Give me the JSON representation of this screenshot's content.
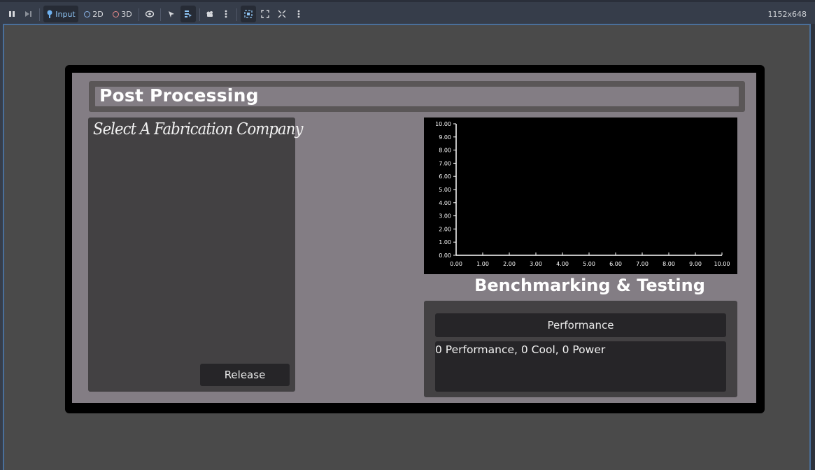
{
  "toolbar": {
    "input_label": "Input",
    "mode_2d_label": "2D",
    "mode_3d_label": "3D",
    "resolution": "1152x648",
    "accent_color": "#4a6f9a"
  },
  "game": {
    "title": "Post Processing",
    "fab_heading": "Select A Fabrication Company",
    "release_label": "Release",
    "bench_title": "Benchmarking & Testing",
    "performance_label": "Performance",
    "result_text": "0 Performance, 0 Cool, 0 Power"
  },
  "chart_data": {
    "type": "line",
    "xlim": [
      0,
      10
    ],
    "ylim": [
      0,
      10
    ],
    "x_ticks": [
      "0.00",
      "1.00",
      "2.00",
      "3.00",
      "4.00",
      "5.00",
      "6.00",
      "7.00",
      "8.00",
      "9.00",
      "10.00"
    ],
    "y_ticks": [
      "0.00",
      "1.00",
      "2.00",
      "3.00",
      "4.00",
      "5.00",
      "6.00",
      "7.00",
      "8.00",
      "9.00",
      "10.00"
    ],
    "series": [],
    "grid": false,
    "background": "#000000",
    "axis_color": "#ffffff"
  }
}
